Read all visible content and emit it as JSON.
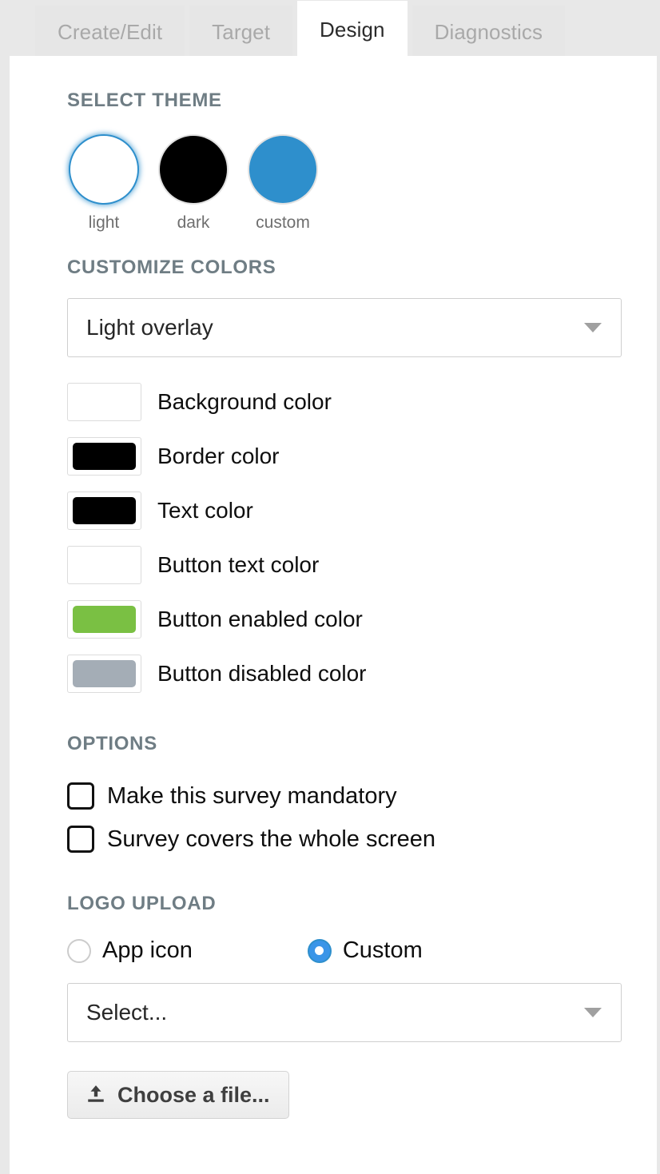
{
  "tabs": [
    {
      "label": "Create/Edit",
      "active": false
    },
    {
      "label": "Target",
      "active": false
    },
    {
      "label": "Design",
      "active": true
    },
    {
      "label": "Diagnostics",
      "active": false
    }
  ],
  "select_theme": {
    "heading": "SELECT THEME",
    "themes": [
      {
        "label": "light",
        "color": "#ffffff",
        "selected": true
      },
      {
        "label": "dark",
        "color": "#000000",
        "selected": false
      },
      {
        "label": "custom",
        "color": "#2e8fcc",
        "selected": false
      }
    ]
  },
  "customize_colors": {
    "heading": "CUSTOMIZE COLORS",
    "overlay_select": {
      "value": "Light overlay",
      "arrow": "chevron-down-icon"
    },
    "swatches": [
      {
        "label": "Background color",
        "color": "#ffffff"
      },
      {
        "label": "Border color",
        "color": "#000000"
      },
      {
        "label": "Text color",
        "color": "#000000"
      },
      {
        "label": "Button text color",
        "color": "#ffffff"
      },
      {
        "label": "Button enabled color",
        "color": "#7ac043"
      },
      {
        "label": "Button disabled color",
        "color": "#a4adb6"
      }
    ]
  },
  "options": {
    "heading": "OPTIONS",
    "items": [
      {
        "label": "Make this survey mandatory",
        "checked": false
      },
      {
        "label": "Survey covers the whole screen",
        "checked": false
      }
    ]
  },
  "logo_upload": {
    "heading": "LOGO UPLOAD",
    "radios": [
      {
        "label": "App icon",
        "checked": false
      },
      {
        "label": "Custom",
        "checked": true
      }
    ],
    "logo_select": {
      "value": "Select...",
      "arrow": "chevron-down-icon"
    },
    "file_button": {
      "label": "Choose a file...",
      "icon": "upload-icon"
    }
  },
  "colors": {
    "accent_blue": "#2e8fcc",
    "radio_blue": "#3a95e8",
    "heading_gray": "#6f7d84",
    "tab_inactive_text": "#a9a9a9",
    "panel_bg": "#ffffff",
    "page_bg": "#e8e8e8"
  }
}
